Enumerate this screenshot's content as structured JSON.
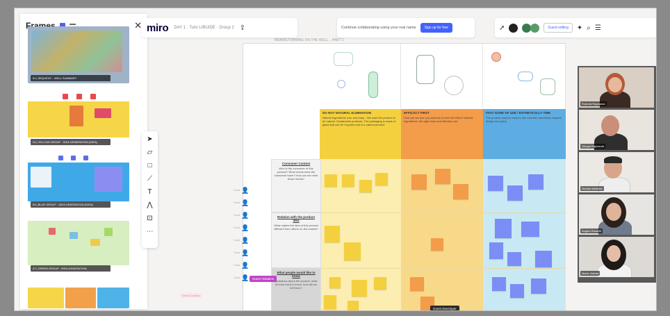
{
  "frames_panel": {
    "title": "Frames",
    "frames": [
      {
        "label": "01 | SEQUENT... WELL SUMMARY"
      },
      {
        "label": "03 | YELLOW GROUP · IDEA GENERATION (IDEA)"
      },
      {
        "label": "04 | BLUE GROUP · IDEA GENERATION (IDEA)"
      },
      {
        "label": "07 | GREEN GROUP · IDEA GENERATION"
      }
    ]
  },
  "topbar": {
    "logo": "miro",
    "board_name": "DAY 1 · Tulsi LIBUIDE · Group 2",
    "collab_text": "Continue collaborating using your real name",
    "signup": "Sign up for free",
    "guest_editing": "Guest editing"
  },
  "board": {
    "title": "BRAINSTORMING ON THE WELL... PART 1",
    "categories": [
      {
        "title": "DO NOT NATURAL ELIMINATION",
        "text": "Natural ingredients over and tasty... We want the product to be natural. Sustainable products: The packaging is made of glass that can be recycled and is a natural product."
      },
      {
        "title": "EFFICACY FIRST",
        "text": "How can we use our products to their full effect? Natural ingredients, the right dose and effective use."
      },
      {
        "title": "FAST GONE OF USE / ESTHETICALLY TIME",
        "text": "The product must be easy to use and fast, beautifully shaped; design and quick."
      }
    ],
    "rows": [
      {
        "title": "Consumer Context",
        "text": "Who is the consumer of this product? What needs does the consumer have? How can we meet those needs?"
      },
      {
        "title": "Relation with the product idea",
        "text": "What makes the idea of this product different from others on the market?"
      },
      {
        "title": "What people would like to know",
        "text": "Questions about the product, what do they need to know, how will we tell them?"
      }
    ],
    "users": [
      "Guest",
      "Guest",
      "Guest",
      "Guest",
      "Guest",
      "Guest",
      "Guest",
      "Guest"
    ],
    "guest_tag": "Guest Visitation",
    "guest_tag_2": "Guest Developer",
    "faint_tag": "Guest Contact"
  },
  "video": {
    "participants": [
      {
        "name": "Roberta Rapisarda"
      },
      {
        "name": "Giorgio Rapisarda"
      },
      {
        "name": "Nicolas Martinez"
      },
      {
        "name": "Angela Rossetti"
      },
      {
        "name": "Maria Valente"
      }
    ]
  },
  "colors": {
    "yellow": "#f4d03f",
    "orange": "#f39c4a",
    "blue": "#5dade2",
    "accent": "#4262ff"
  }
}
